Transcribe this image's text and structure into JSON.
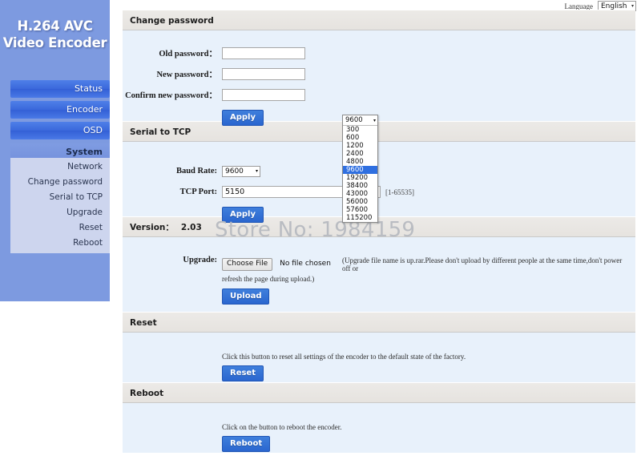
{
  "brand": {
    "line1": "H.264 AVC",
    "line2": "Video Encoder"
  },
  "language_bar": {
    "label": "Language",
    "selected": "English",
    "arrow": "▾"
  },
  "sidebar": {
    "nav": [
      {
        "label": "Status"
      },
      {
        "label": "Encoder"
      },
      {
        "label": "OSD"
      },
      {
        "label": "System"
      }
    ],
    "submenu": [
      {
        "label": "Network"
      },
      {
        "label": "Change password"
      },
      {
        "label": "Serial to TCP"
      },
      {
        "label": "Upgrade"
      },
      {
        "label": "Reset"
      },
      {
        "label": "Reboot"
      }
    ]
  },
  "watermark": "Store No: 1984159",
  "change_password": {
    "title": "Change password",
    "fields": [
      {
        "label": "Old password：",
        "value": ""
      },
      {
        "label": "New password：",
        "value": ""
      },
      {
        "label": "Confirm new password：",
        "value": ""
      }
    ],
    "apply_label": "Apply"
  },
  "serial_to_tcp": {
    "title": "Serial to TCP",
    "baud_label": "Baud Rate:",
    "baud_value": "9600",
    "port_label": "TCP Port:",
    "port_value": "5150",
    "port_hint": "[1-65535]",
    "apply_label": "Apply"
  },
  "baud_dropdown": {
    "current": "9600",
    "arrow": "▾",
    "options": [
      "300",
      "600",
      "1200",
      "2400",
      "4800",
      "9600",
      "19200",
      "38400",
      "43000",
      "56000",
      "57600",
      "115200"
    ],
    "selected_index": 5,
    "highlight_color": "#2f6fe0"
  },
  "version": {
    "title": "Version：",
    "value": "2.03",
    "upgrade_label": "Upgrade:",
    "choose_file_label": "Choose File",
    "file_status": "No file chosen",
    "note_line1": "(Upgrade file name is up.rar.Please don't upload by different people at the same time,don't power off or",
    "note_line2": "refresh the page during upload.)",
    "upload_label": "Upload"
  },
  "reset": {
    "title": "Reset",
    "description": "Click this button to reset all settings of the encoder to the default state of the factory.",
    "button_label": "Reset"
  },
  "reboot": {
    "title": "Reboot",
    "description": "Click on the button to reboot the encoder.",
    "button_label": "Reboot"
  }
}
